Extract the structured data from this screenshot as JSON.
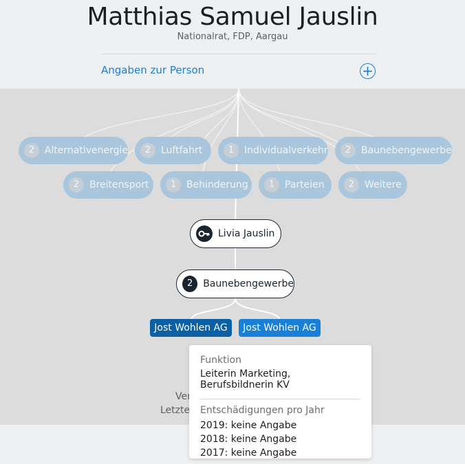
{
  "header": {
    "name": "Matthias Samuel Jauslin",
    "subtitle": "Nationalrat, FDP, Aargau",
    "angaben_label": "Angaben zur Person",
    "expand_glyph": "+"
  },
  "groups": [
    {
      "count": "2",
      "label": "Alternativenergie"
    },
    {
      "count": "2",
      "label": "Luftfahrt"
    },
    {
      "count": "1",
      "label": "Individualverkehr"
    },
    {
      "count": "2",
      "label": "Baunebengewerbe"
    },
    {
      "count": "2",
      "label": "Breitensport"
    },
    {
      "count": "1",
      "label": "Behinderung"
    },
    {
      "count": "1",
      "label": "Parteien"
    },
    {
      "count": "2",
      "label": "Weitere"
    }
  ],
  "guest": {
    "label": "Livia Jauslin",
    "icon": "key-icon"
  },
  "selected_group": {
    "count": "2",
    "label": "Baunebengewerbe"
  },
  "orgs": [
    {
      "label": "Jost Wohlen AG",
      "color": "#0b5fa5"
    },
    {
      "label": "Jost Wohlen AG",
      "color": "#1a7fd6"
    }
  ],
  "stamp": {
    "line1": "Ver",
    "line2": "Letzte"
  },
  "tooltip": {
    "funktion_label": "Funktion",
    "funktion_value": "Leiterin Marketing, Berufsbildnerin KV",
    "entschaedigung_label": "Entschädigungen pro Jahr",
    "years": [
      "2019: keine Angabe",
      "2018: keine Angabe",
      "2017: keine Angabe"
    ]
  },
  "colors": {
    "accent": "#1a7fd6",
    "dark": "#1b2530",
    "pill_faded": "#a9c6dc",
    "stage_bg": "#dcdcdc"
  }
}
